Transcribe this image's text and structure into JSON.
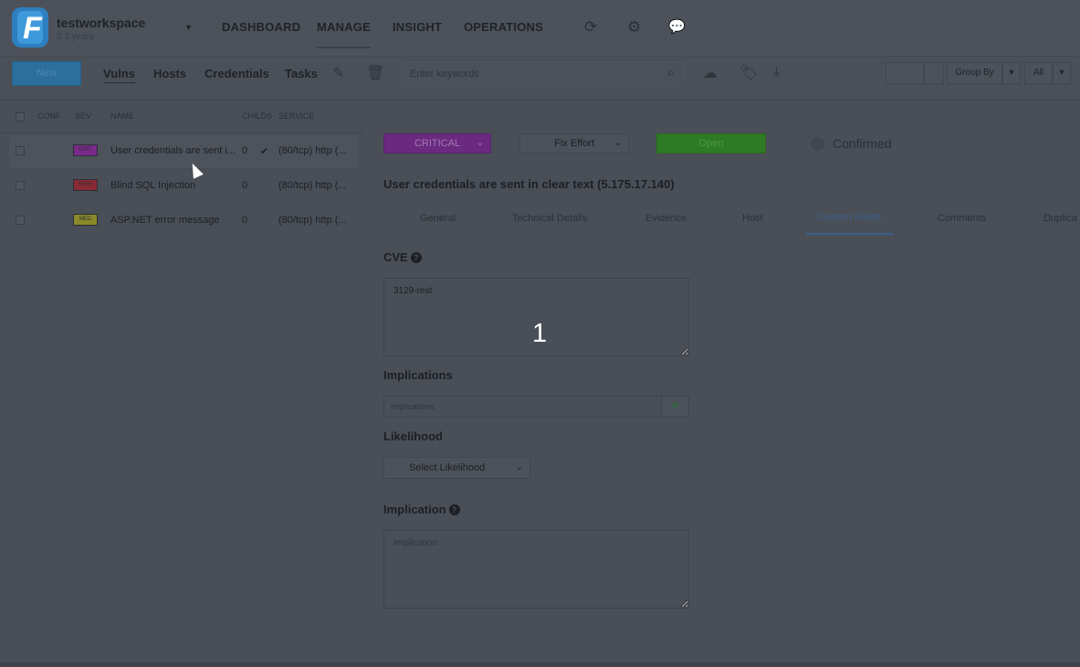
{
  "workspace": {
    "name": "testworkspace",
    "subtitle": "3 3 years",
    "logo_letter": "F"
  },
  "nav": {
    "dashboard": "DASHBOARD",
    "manage": "MANAGE",
    "insight": "INSIGHT",
    "operations": "OPERATIONS"
  },
  "top_icons": {
    "refresh": "⟳",
    "settings": "⚙",
    "chat": "💬"
  },
  "toolbar": {
    "new_label": "New",
    "tabs": {
      "vulns": "Vulns",
      "hosts": "Hosts",
      "credentials": "Credentials",
      "tasks": "Tasks"
    },
    "search_placeholder": "Enter keywords",
    "group_by": "Group By",
    "all": "All"
  },
  "table": {
    "headers": {
      "conf": "CONF",
      "sev": "SEV",
      "name": "NAME",
      "childs": "CHILDS",
      "service": "SERVICE"
    },
    "rows": [
      {
        "sev_label": "CRIT",
        "sev_color": "#7a2a8a",
        "name": "User credentials are sent i...",
        "childs": "0",
        "confirmed": "✔",
        "service": "(80/tcp) http (..."
      },
      {
        "sev_label": "HIGH",
        "sev_color": "#8a2a34",
        "name": "Blind SQL Injection",
        "childs": "0",
        "confirmed": "",
        "service": "(80/tcp) http (..."
      },
      {
        "sev_label": "MED",
        "sev_color": "#8a8a2a",
        "name": "ASP.NET error message",
        "childs": "0",
        "confirmed": "",
        "service": "(80/tcp) http (..."
      }
    ]
  },
  "detail": {
    "severity": "CRITICAL",
    "fix_effort": "Fix Effort",
    "status": "Open",
    "confirmed": "Confirmed",
    "title": "User credentials are sent in clear text (5.175.17.140)",
    "tabs": {
      "general": "General",
      "technical": "Technical Details",
      "evidence": "Evidence",
      "host": "Host",
      "custom": "Custom Fields",
      "comments": "Comments",
      "duplicates": "Duplica"
    },
    "cve_label": "CVE",
    "cve_value": "3129-rest",
    "implications_label": "Implications",
    "implications_placeholder": "Implications",
    "likelihood_label": "Likelihood",
    "likelihood_select": "Select Likelihood",
    "implication_label": "Implication",
    "implication_placeholder": "Implication"
  },
  "overlay_number": "1",
  "colors": {
    "critical": "#6b2a80",
    "open": "#2f7a24",
    "accent": "#3a5f8a"
  }
}
